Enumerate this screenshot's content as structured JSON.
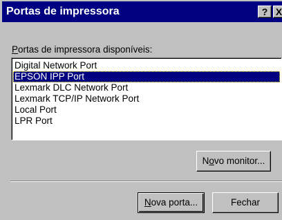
{
  "window": {
    "title": "Portas de impressora",
    "help_button": "?",
    "close_button": "X"
  },
  "list": {
    "label_accel": "P",
    "label_rest": "ortas de impressora disponíveis:",
    "items": [
      "Digital Network Port",
      "EPSON IPP Port",
      "Lexmark DLC Network Port",
      "Lexmark TCP/IP Network Port",
      "Local Port",
      "LPR Port"
    ],
    "selected_item": "EPSON IPP Port"
  },
  "buttons": {
    "novo_monitor": {
      "pre": "N",
      "accel": "o",
      "post": "vo monitor..."
    },
    "nova_porta": {
      "pre": "",
      "accel": "N",
      "post": "ova porta..."
    },
    "fechar": "Fechar"
  },
  "colors": {
    "titlebar": "#000080",
    "face": "#c0c0c0",
    "selection": "#000080"
  }
}
